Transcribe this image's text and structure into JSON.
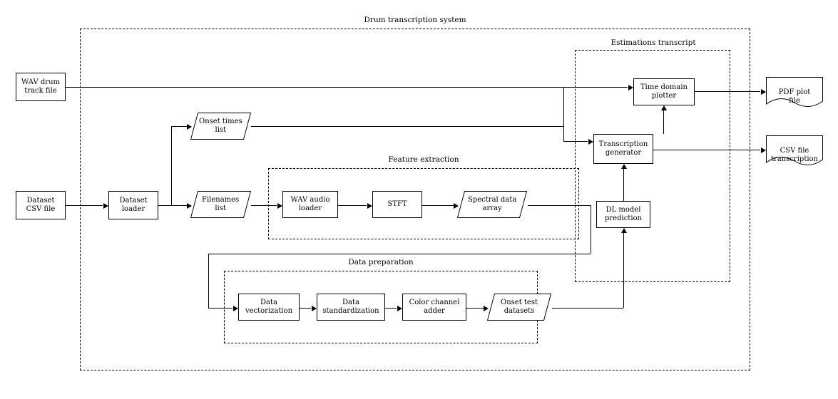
{
  "groups": {
    "main": {
      "label": "Drum transcription system"
    },
    "feature": {
      "label": "Feature extraction"
    },
    "prep": {
      "label": "Data preparation"
    },
    "est": {
      "label": "Estimations transcript"
    }
  },
  "nodes": {
    "wav_in": {
      "label": "WAV drum\ntrack file"
    },
    "dataset_csv": {
      "label": "Dataset\nCSV file"
    },
    "dataset_loader": {
      "label": "Dataset\nloader"
    },
    "onset_times": {
      "label": "Onset times\nlist"
    },
    "filenames": {
      "label": "Filenames\nlist"
    },
    "wav_loader": {
      "label": "WAV audio\nloader"
    },
    "stft": {
      "label": "STFT"
    },
    "spectral": {
      "label": "Spectral data\narray"
    },
    "data_vec": {
      "label": "Data\nvectorization"
    },
    "data_std": {
      "label": "Data\nstandardization"
    },
    "color_ch": {
      "label": "Color channel\nadder"
    },
    "onset_test": {
      "label": "Onset test\ndatasets"
    },
    "dl_pred": {
      "label": "DL model\nprediction"
    },
    "trans_gen": {
      "label": "Transcription\ngenerator"
    },
    "time_plotter": {
      "label": "Time domain\nplotter"
    },
    "pdf_out": {
      "label": "PDF plot\nfile"
    },
    "csv_out": {
      "label": "CSV file\ntranscription"
    }
  }
}
